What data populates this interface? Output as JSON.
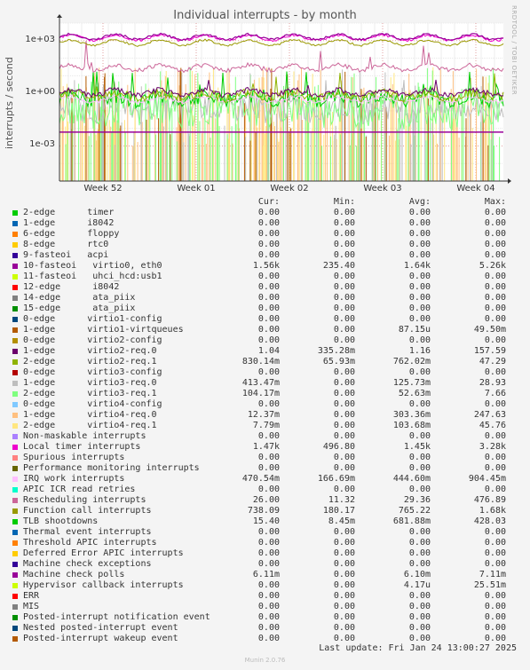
{
  "title": "Individual interrupts - by month",
  "watermark": "RRDTOOL / TOBI OETIKER",
  "footer_version": "Munin 2.0.76",
  "last_update": "Last update: Fri Jan 24 13:00:27 2025",
  "legend_headers": {
    "cur": "Cur:",
    "min": "Min:",
    "avg": "Avg:",
    "max": "Max:"
  },
  "chart_data": {
    "type": "line",
    "title": "Individual interrupts - by month",
    "ylabel": "interrupts / second",
    "yscale": "log",
    "ylim": [
      1e-05,
      10000
    ],
    "ytick_labels": [
      "1e+03",
      "1e+00",
      "1e-03"
    ],
    "xtick_labels": [
      "Week 52",
      "Week 01",
      "Week 02",
      "Week 03",
      "Week 04"
    ],
    "grid": true,
    "legend_placement": "below",
    "series": [
      {
        "name": "2-edge      timer",
        "color": "#00cc00",
        "cur": "0.00",
        "min": "0.00",
        "avg": "0.00",
        "max": "0.00"
      },
      {
        "name": "1-edge      i8042",
        "color": "#0066b3",
        "cur": "0.00",
        "min": "0.00",
        "avg": "0.00",
        "max": "0.00"
      },
      {
        "name": "6-edge      floppy",
        "color": "#ff8000",
        "cur": "0.00",
        "min": "0.00",
        "avg": "0.00",
        "max": "0.00"
      },
      {
        "name": "8-edge      rtc0",
        "color": "#ffcc00",
        "cur": "0.00",
        "min": "0.00",
        "avg": "0.00",
        "max": "0.00"
      },
      {
        "name": "9-fasteoi   acpi",
        "color": "#330099",
        "cur": "0.00",
        "min": "0.00",
        "avg": "0.00",
        "max": "0.00"
      },
      {
        "name": "10-fasteoi   virtio0, eth0",
        "color": "#990099",
        "cur": "1.56k",
        "min": "235.40",
        "avg": "1.64k",
        "max": "5.26k"
      },
      {
        "name": "11-fasteoi   uhci_hcd:usb1",
        "color": "#ccff00",
        "cur": "0.00",
        "min": "0.00",
        "avg": "0.00",
        "max": "0.00"
      },
      {
        "name": "12-edge      i8042",
        "color": "#ff0000",
        "cur": "0.00",
        "min": "0.00",
        "avg": "0.00",
        "max": "0.00"
      },
      {
        "name": "14-edge      ata_piix",
        "color": "#808080",
        "cur": "0.00",
        "min": "0.00",
        "avg": "0.00",
        "max": "0.00"
      },
      {
        "name": "15-edge      ata_piix",
        "color": "#008f00",
        "cur": "0.00",
        "min": "0.00",
        "avg": "0.00",
        "max": "0.00"
      },
      {
        "name": "0-edge      virtio1-config",
        "color": "#00487d",
        "cur": "0.00",
        "min": "0.00",
        "avg": "0.00",
        "max": "0.00"
      },
      {
        "name": "1-edge      virtio1-virtqueues",
        "color": "#b35a00",
        "cur": "0.00",
        "min": "0.00",
        "avg": "87.15u",
        "max": "49.50m"
      },
      {
        "name": "0-edge      virtio2-config",
        "color": "#b38f00",
        "cur": "0.00",
        "min": "0.00",
        "avg": "0.00",
        "max": "0.00"
      },
      {
        "name": "1-edge      virtio2-req.0",
        "color": "#6b006b",
        "cur": "1.04",
        "min": "335.28m",
        "avg": "1.16",
        "max": "157.59"
      },
      {
        "name": "2-edge      virtio2-req.1",
        "color": "#8fb300",
        "cur": "830.14m",
        "min": "65.93m",
        "avg": "762.02m",
        "max": "47.29"
      },
      {
        "name": "0-edge      virtio3-config",
        "color": "#b30000",
        "cur": "0.00",
        "min": "0.00",
        "avg": "0.00",
        "max": "0.00"
      },
      {
        "name": "1-edge      virtio3-req.0",
        "color": "#bebebe",
        "cur": "413.47m",
        "min": "0.00",
        "avg": "125.73m",
        "max": "28.93"
      },
      {
        "name": "2-edge      virtio3-req.1",
        "color": "#80ff80",
        "cur": "104.17m",
        "min": "0.00",
        "avg": "52.63m",
        "max": "7.66"
      },
      {
        "name": "0-edge      virtio4-config",
        "color": "#80c9ff",
        "cur": "0.00",
        "min": "0.00",
        "avg": "0.00",
        "max": "0.00"
      },
      {
        "name": "1-edge      virtio4-req.0",
        "color": "#ffc080",
        "cur": "12.37m",
        "min": "0.00",
        "avg": "303.36m",
        "max": "247.63"
      },
      {
        "name": "2-edge      virtio4-req.1",
        "color": "#ffe680",
        "cur": "7.79m",
        "min": "0.00",
        "avg": "103.68m",
        "max": "45.76"
      },
      {
        "name": "Non-maskable interrupts",
        "color": "#aa80ff",
        "cur": "0.00",
        "min": "0.00",
        "avg": "0.00",
        "max": "0.00"
      },
      {
        "name": "Local timer interrupts",
        "color": "#ee00cc",
        "cur": "1.47k",
        "min": "496.80",
        "avg": "1.45k",
        "max": "3.28k"
      },
      {
        "name": "Spurious interrupts",
        "color": "#ff8080",
        "cur": "0.00",
        "min": "0.00",
        "avg": "0.00",
        "max": "0.00"
      },
      {
        "name": "Performance monitoring interrupts",
        "color": "#666600",
        "cur": "0.00",
        "min": "0.00",
        "avg": "0.00",
        "max": "0.00"
      },
      {
        "name": "IRQ work interrupts",
        "color": "#ffbfff",
        "cur": "470.54m",
        "min": "166.69m",
        "avg": "444.60m",
        "max": "904.45m"
      },
      {
        "name": "APIC ICR read retries",
        "color": "#00ffcc",
        "cur": "0.00",
        "min": "0.00",
        "avg": "0.00",
        "max": "0.00"
      },
      {
        "name": "Rescheduling interrupts",
        "color": "#cc6699",
        "cur": "26.00",
        "min": "11.32",
        "avg": "29.36",
        "max": "476.89"
      },
      {
        "name": "Function call interrupts",
        "color": "#999900",
        "cur": "738.09",
        "min": "180.17",
        "avg": "765.22",
        "max": "1.68k"
      },
      {
        "name": "TLB shootdowns",
        "color": "#00cc00",
        "cur": "15.40",
        "min": "8.45m",
        "avg": "681.88m",
        "max": "428.03"
      },
      {
        "name": "Thermal event interrupts",
        "color": "#0066b3",
        "cur": "0.00",
        "min": "0.00",
        "avg": "0.00",
        "max": "0.00"
      },
      {
        "name": "Threshold APIC interrupts",
        "color": "#ff8000",
        "cur": "0.00",
        "min": "0.00",
        "avg": "0.00",
        "max": "0.00"
      },
      {
        "name": "Deferred Error APIC interrupts",
        "color": "#ffcc00",
        "cur": "0.00",
        "min": "0.00",
        "avg": "0.00",
        "max": "0.00"
      },
      {
        "name": "Machine check exceptions",
        "color": "#330099",
        "cur": "0.00",
        "min": "0.00",
        "avg": "0.00",
        "max": "0.00"
      },
      {
        "name": "Machine check polls",
        "color": "#990099",
        "cur": "6.11m",
        "min": "0.00",
        "avg": "6.10m",
        "max": "7.11m"
      },
      {
        "name": "Hypervisor callback interrupts",
        "color": "#ccff00",
        "cur": "0.00",
        "min": "0.00",
        "avg": "4.17u",
        "max": "25.51m"
      },
      {
        "name": "ERR",
        "color": "#ff0000",
        "cur": "0.00",
        "min": "0.00",
        "avg": "0.00",
        "max": "0.00"
      },
      {
        "name": "MIS",
        "color": "#808080",
        "cur": "0.00",
        "min": "0.00",
        "avg": "0.00",
        "max": "0.00"
      },
      {
        "name": "Posted-interrupt notification event",
        "color": "#008f00",
        "cur": "0.00",
        "min": "0.00",
        "avg": "0.00",
        "max": "0.00"
      },
      {
        "name": "Nested posted-interrupt event",
        "color": "#00487d",
        "cur": "0.00",
        "min": "0.00",
        "avg": "0.00",
        "max": "0.00"
      },
      {
        "name": "Posted-interrupt wakeup event",
        "color": "#b35a00",
        "cur": "0.00",
        "min": "0.00",
        "avg": "0.00",
        "max": "0.00"
      }
    ]
  }
}
